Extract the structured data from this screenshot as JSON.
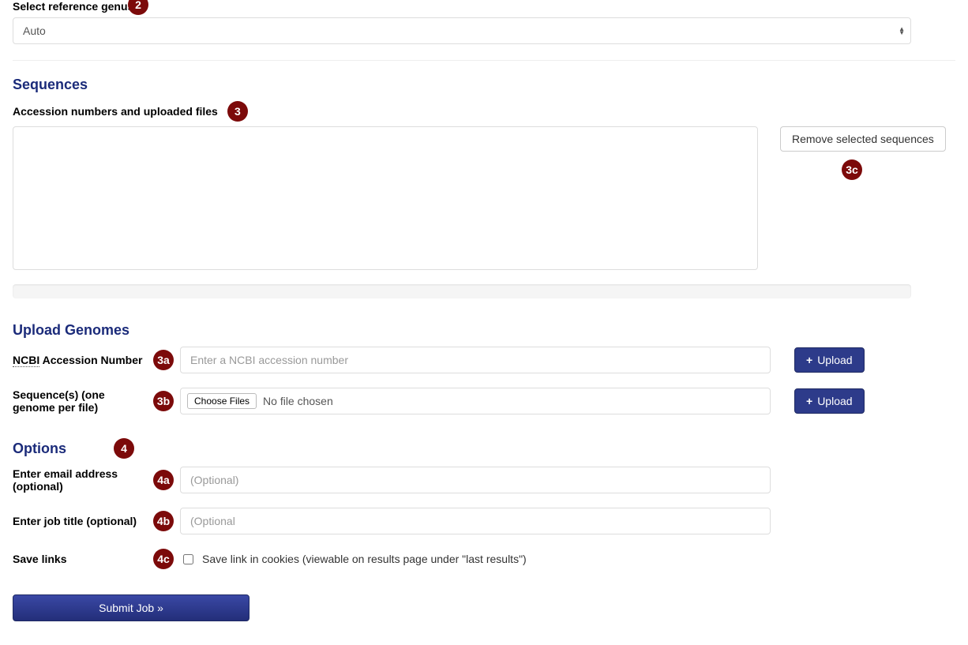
{
  "reference": {
    "label": "Select reference genus:",
    "selected": "Auto"
  },
  "badges": {
    "b2": "2",
    "b3": "3",
    "b3a": "3a",
    "b3b": "3b",
    "b3c": "3c",
    "b4": "4",
    "b4a": "4a",
    "b4b": "4b",
    "b4c": "4c"
  },
  "sequences": {
    "heading": "Sequences",
    "sublabel": "Accession numbers and uploaded files",
    "remove_btn": "Remove selected sequences"
  },
  "upload": {
    "heading": "Upload Genomes",
    "ncbi_label_abbr": "NCBI",
    "ncbi_label_rest": " Accession Number",
    "ncbi_placeholder": "Enter a NCBI accession number",
    "seq_label": "Sequence(s) (one genome per file)",
    "choose_label": "Choose Files",
    "no_file": "No file chosen",
    "upload_btn": "Upload",
    "plus": "+"
  },
  "options": {
    "heading": "Options",
    "email_label": "Enter email address (optional)",
    "email_placeholder": "(Optional)",
    "title_label": "Enter job title (optional)",
    "title_placeholder": "(Optional",
    "savelinks_label": "Save links",
    "savelinks_text": "Save link in cookies (viewable on results page under \"last results\")"
  },
  "submit_label": "Submit Job »"
}
